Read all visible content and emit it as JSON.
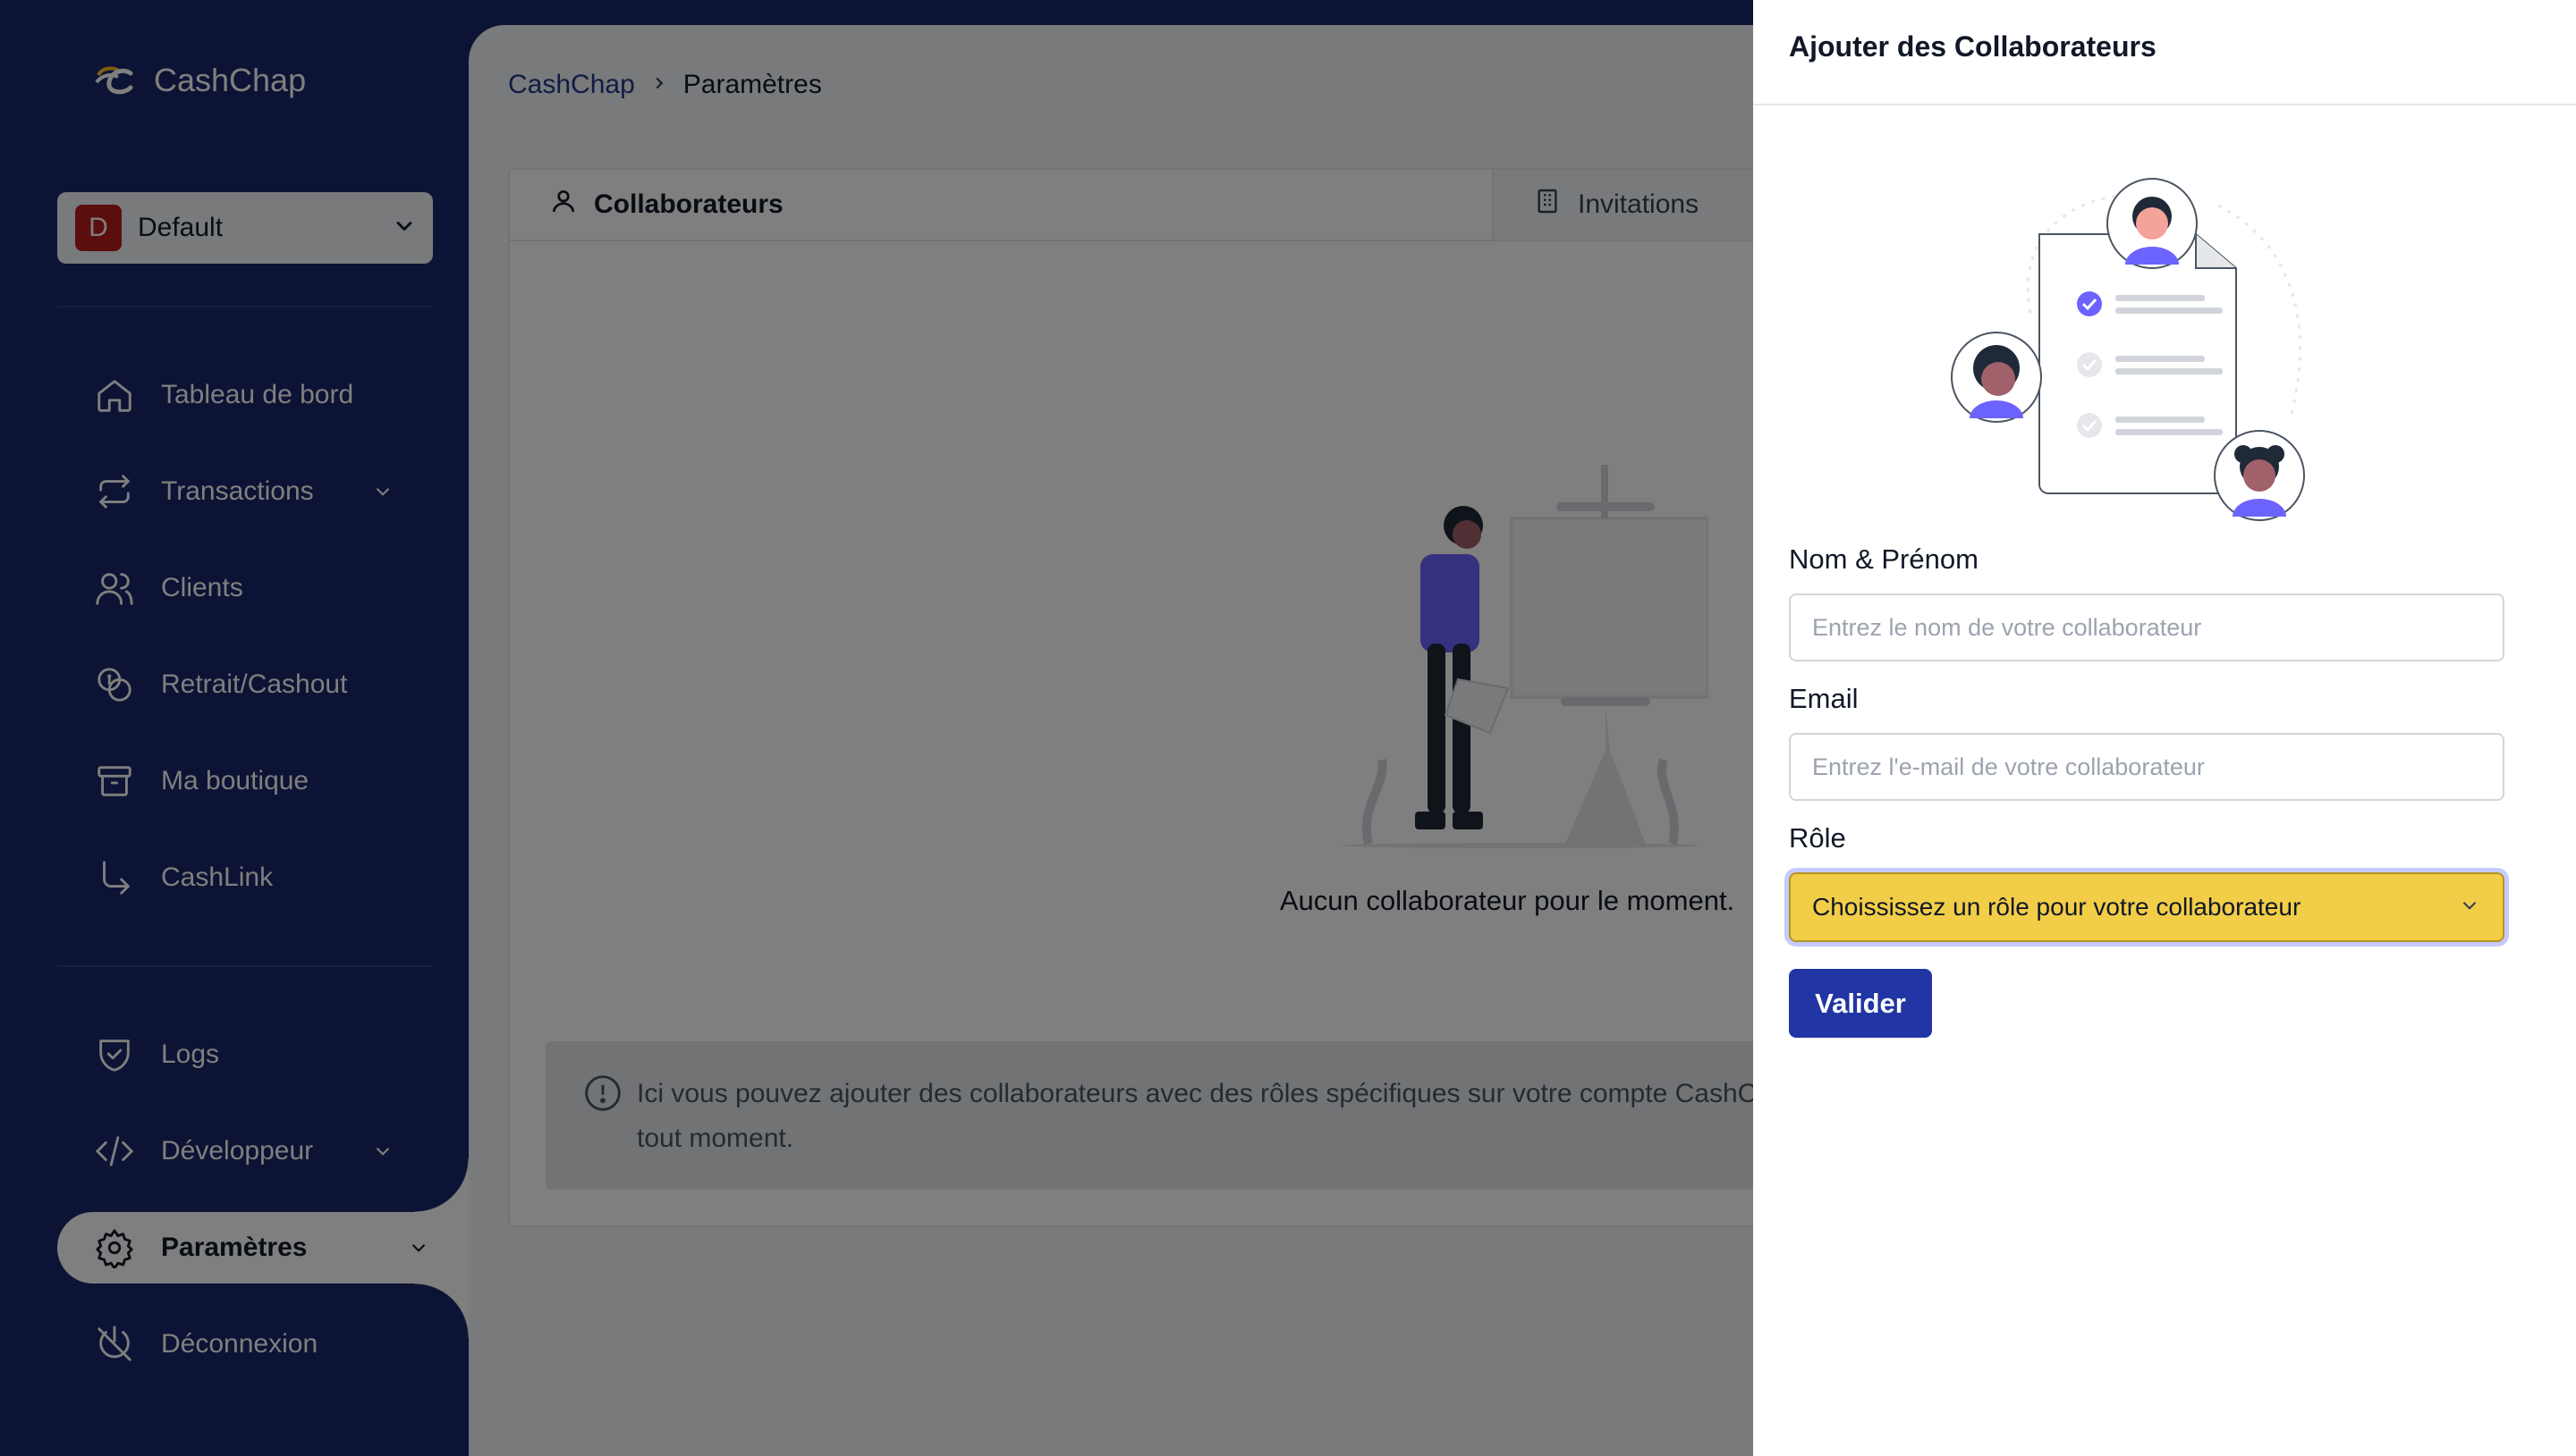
{
  "app": {
    "name": "CashChap"
  },
  "workspace": {
    "initial": "D",
    "name": "Default"
  },
  "sidebar": {
    "items": [
      {
        "label": "Tableau de bord",
        "icon": "home-icon"
      },
      {
        "label": "Transactions",
        "icon": "arrows-exchange-icon",
        "expandable": true
      },
      {
        "label": "Clients",
        "icon": "users-icon"
      },
      {
        "label": "Retrait/Cashout",
        "icon": "coins-icon"
      },
      {
        "label": "Ma boutique",
        "icon": "archive-box-icon"
      },
      {
        "label": "CashLink",
        "icon": "arrow-turn-right-icon"
      }
    ],
    "bottom_items": [
      {
        "label": "Logs",
        "icon": "shield-check-icon"
      },
      {
        "label": "Développeur",
        "icon": "code-icon",
        "expandable": true
      },
      {
        "label": "Paramètres",
        "icon": "gear-icon",
        "expandable": true,
        "active": true
      },
      {
        "label": "Déconnexion",
        "icon": "power-off-icon"
      }
    ]
  },
  "breadcrumb": {
    "root": "CashChap",
    "current": "Paramètres"
  },
  "tabs": [
    {
      "label": "Collaborateurs",
      "icon": "user-icon",
      "active": true
    },
    {
      "label": "Invitations",
      "icon": "building-icon",
      "active": false
    }
  ],
  "empty_state": {
    "text": "Aucun collaborateur pour le moment."
  },
  "notice": {
    "text": "Ici vous pouvez ajouter des collaborateurs avec des rôles spécifiques sur votre compte CashChap et les retirer à tout moment."
  },
  "drawer": {
    "title": "Ajouter des Collaborateurs",
    "name_label": "Nom & Prénom",
    "name_placeholder": "Entrez le nom de votre collaborateur",
    "email_label": "Email",
    "email_placeholder": "Entrez l'e-mail de votre collaborateur",
    "role_label": "Rôle",
    "role_value": "Choississez un rôle pour votre collaborateur",
    "submit_label": "Valider"
  },
  "colors": {
    "sidebar_bg": "#1a2669",
    "accent": "#2135a4",
    "role_select_bg": "#f2cd47",
    "illustration_purple": "#6c63ff"
  }
}
